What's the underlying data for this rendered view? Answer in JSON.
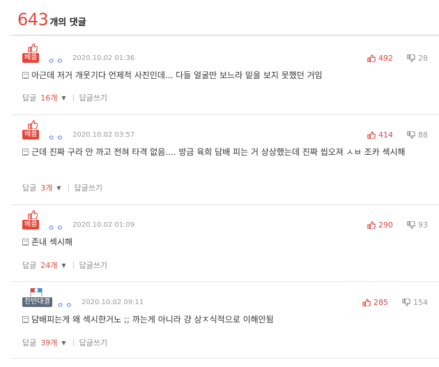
{
  "header": {
    "count": "643",
    "title": "개의 댓글"
  },
  "comments": [
    {
      "badge": "베플",
      "user": "ㅇㅇ",
      "date": "2020.10.02 01:36",
      "likes": "492",
      "dislikes": "28",
      "text": "아근데 저거 개웃기다 언제적 사진인데... 다들 얼굴만 보느라 밑을 보지 못했던 거임",
      "reply_label": "답글",
      "reply_count": "16개",
      "write_reply": "답글쓰기"
    },
    {
      "badge": "베플",
      "user": "ㅇㅇ",
      "date": "2020.10.02 03:57",
      "likes": "414",
      "dislikes": "88",
      "text": "근데 진짜 구라 안 까고 전혀 타격 없음.... 방금 육희 담배 피는 거 상상했는데 진짜 씹오져 ㅅㅂ 조카 섹시해",
      "reply_label": "답글",
      "reply_count": "3개",
      "write_reply": "답글쓰기"
    },
    {
      "badge": "베플",
      "user": "ㅇㅇ",
      "date": "2020.10.02 01:09",
      "likes": "290",
      "dislikes": "93",
      "text": "존내 섹시해",
      "reply_label": "답글",
      "reply_count": "24개",
      "write_reply": "답글쓰기"
    },
    {
      "badge": "찬반대결",
      "user": "ㅇㅇ",
      "date": "2020.10.02 09:11",
      "likes": "285",
      "dislikes": "154",
      "text": "담배피는게 왜 섹시한거노 ;; 까는게 아니라 걍 상ㅈ식적으로 이해안됨",
      "reply_label": "답글",
      "reply_count": "39개",
      "write_reply": "답글쓰기"
    }
  ],
  "icons": {
    "best": "thumbs-up-icon",
    "debate": "flag-icon",
    "like": "thumbs-up-icon",
    "dislike": "thumbs-down-icon",
    "document": "document-icon",
    "caret": "caret-down-icon"
  },
  "colors": {
    "accent": "#e2463a",
    "user": "#3a62c6",
    "debate_badge": "#5b6a7c"
  }
}
